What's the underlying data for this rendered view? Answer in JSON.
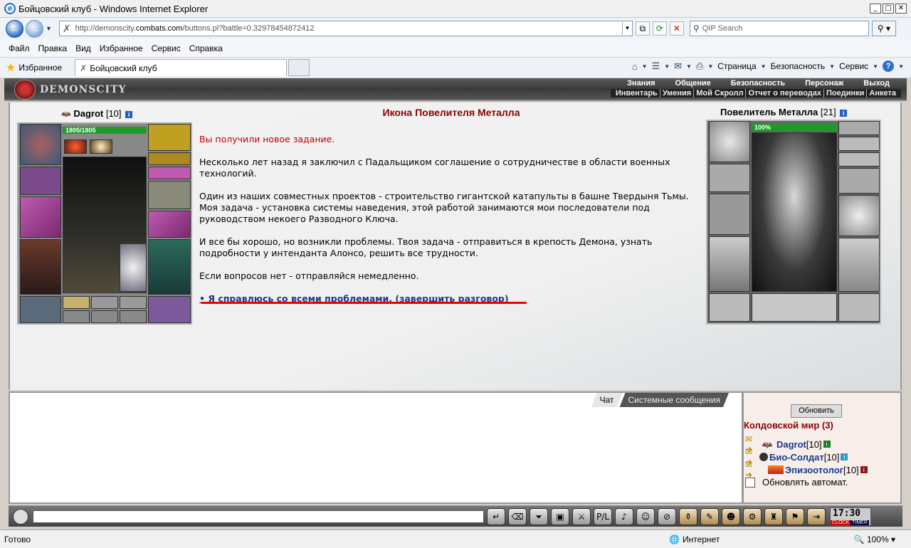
{
  "window": {
    "title": "Бойцовский клуб - Windows Internet Explorer"
  },
  "address": {
    "url_prefix": "http://demonscity.",
    "url_domain": "combats.com",
    "url_suffix": "/buttons.pl?battle=0.32978454872412",
    "search_placeholder": "QIP Search"
  },
  "menu": [
    "Файл",
    "Правка",
    "Вид",
    "Избранное",
    "Сервис",
    "Справка"
  ],
  "favorites": {
    "label": "Избранное",
    "tab_title": "Бойцовский клуб"
  },
  "commandbar": {
    "page": "Страница",
    "security": "Безопасность",
    "service": "Сервис"
  },
  "game": {
    "logo": "DEMONSCITY",
    "nav_top": [
      "Знания",
      "Общение",
      "Безопасность",
      "Персонаж",
      "Выход"
    ],
    "nav_bottom": [
      "Инвентарь",
      "Умения",
      "Мой Скролл",
      "Отчет о переводах",
      "Поединки",
      "Анкета"
    ]
  },
  "player": {
    "name": "Dagrot",
    "level": "[10]",
    "hp": "1805/1805"
  },
  "npc": {
    "title": "Икона Повелителя Металла",
    "name": "Повелитель Металла",
    "level": "[21]",
    "hp": "100%"
  },
  "dialog": {
    "new_task": "Вы получили новое задание.",
    "p1": "Несколько лет назад я заключил с Падальщиком соглашение о сотрудничестве в области военных технологий.",
    "p2": "Один из наших совместных проектов - строительство гигантской катапульты в башне Твердыня Тьмы. Моя задача - установка системы наведения, этой работой занимаются мои последователи под руководством некоего Разводного Ключа.",
    "p3": "И все бы хорошо, но возникли проблемы. Твоя задача - отправиться в крепость Демона, узнать подробности у интенданта Алонсо, решить все трудности.",
    "p4": "Если вопросов нет - отправляйся немедленно.",
    "answer": "• Я справлюсь со всеми проблемами. (завершить разговор)"
  },
  "chat": {
    "tab_chat": "Чат",
    "tab_system": "Системные сообщения"
  },
  "online": {
    "refresh": "Обновить",
    "world": "Колдовской мир (3)",
    "users": [
      {
        "name": "Dagrot",
        "level": "[10]"
      },
      {
        "name": "Био-Солдат",
        "level": "[10]"
      },
      {
        "name": "Эпизоотолог",
        "level": "[10]"
      }
    ],
    "auto_refresh": "Обновлять автомат."
  },
  "clock": {
    "time": "17:30",
    "tag1": "CLOCK",
    "tag2": "TIMER"
  },
  "status": {
    "ready": "Готово",
    "zone": "Интернет",
    "zoom": "100%"
  },
  "colors": {
    "npc_title": "#8b0000",
    "new_task": "#c00000",
    "answer_link": "#1a3a8a",
    "hp_bar": "#1f9a2a"
  }
}
